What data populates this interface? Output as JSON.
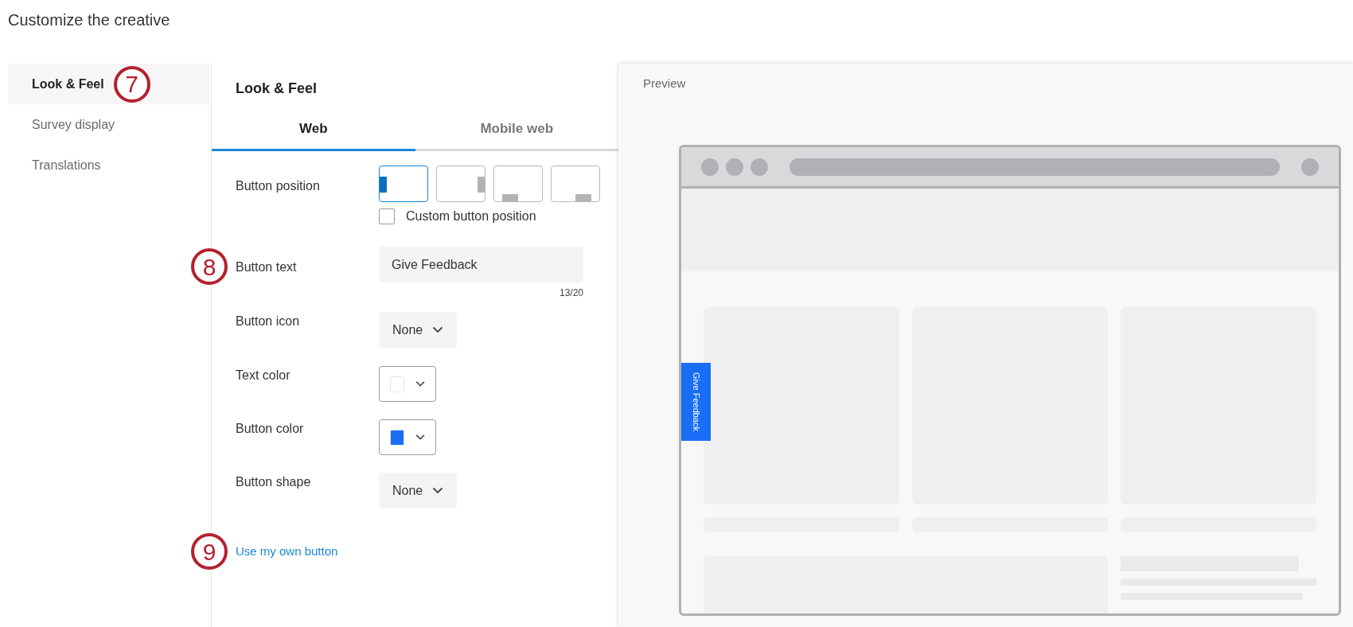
{
  "page": {
    "title": "Customize the creative"
  },
  "sidebar": {
    "items": [
      {
        "label": "Look & Feel",
        "selected": true,
        "callout": "7"
      },
      {
        "label": "Survey display",
        "selected": false
      },
      {
        "label": "Translations",
        "selected": false
      }
    ]
  },
  "panel": {
    "title": "Look & Feel",
    "tabs": [
      {
        "label": "Web",
        "selected": true
      },
      {
        "label": "Mobile web",
        "selected": false
      }
    ],
    "fields": [
      {
        "kind": "position",
        "label": "Button position",
        "options": [
          {
            "kind": "left",
            "selected": true
          },
          {
            "kind": "right",
            "selected": false
          },
          {
            "kind": "bottom",
            "selected": false
          },
          {
            "kind": "corner",
            "selected": false
          }
        ],
        "checkbox": {
          "label": "Custom button position",
          "checked": false
        }
      },
      {
        "kind": "text",
        "label": "Button text",
        "value": "Give Feedback",
        "counter": "13/20",
        "callout": "8"
      },
      {
        "kind": "select",
        "label": "Button icon",
        "value": "None"
      },
      {
        "kind": "color",
        "label": "Text color",
        "color": "#ffffff"
      },
      {
        "kind": "color",
        "label": "Button color",
        "color": "#1a6ef5"
      },
      {
        "kind": "select",
        "label": "Button shape",
        "value": "None"
      },
      {
        "kind": "link",
        "label": "Use my own button",
        "callout": "9"
      }
    ]
  },
  "preview": {
    "title": "Preview",
    "feedback_button": {
      "text": "Give Feedback"
    }
  }
}
